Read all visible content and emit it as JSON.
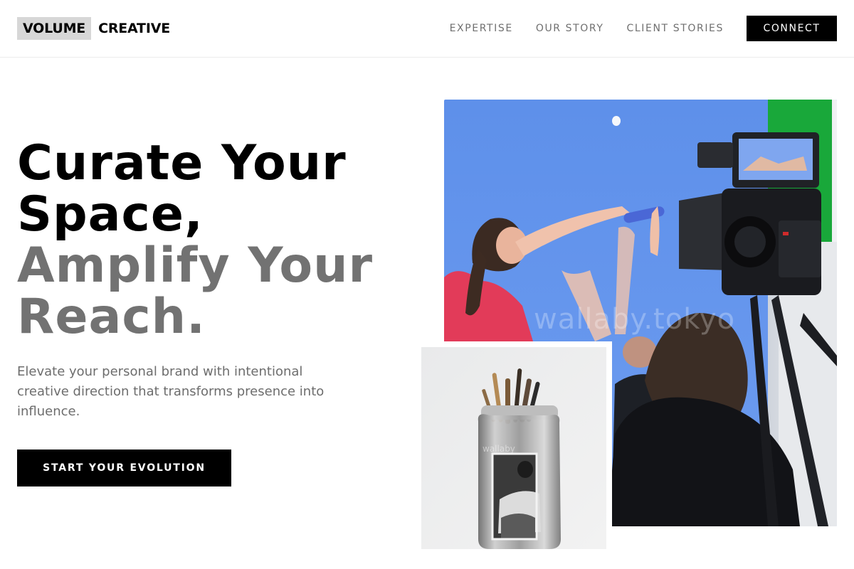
{
  "brand": {
    "boxed_word": "VOLUME",
    "word": "CREATIVE"
  },
  "nav": {
    "links": [
      "EXPERTISE",
      "OUR STORY",
      "CLIENT STORIES"
    ],
    "cta_label": "CONNECT"
  },
  "hero": {
    "title_line1": "Curate Your",
    "title_line2": "Space,",
    "title_line3": "Amplify Your",
    "title_line4": "Reach.",
    "subtitle": "Elevate your personal brand with intentional creative direction that transforms presence into influence.",
    "cta_label": "START YOUR EVOLUTION"
  },
  "images": {
    "main_watermark": "wallaby.tokyo",
    "small_watermark": "wallaby"
  },
  "colors": {
    "accent": "#000000",
    "muted_heading": "#727272",
    "logo_box": "#d7d7d7",
    "backdrop_blue": "#5b8fe8",
    "screen_green": "#17b03a"
  }
}
